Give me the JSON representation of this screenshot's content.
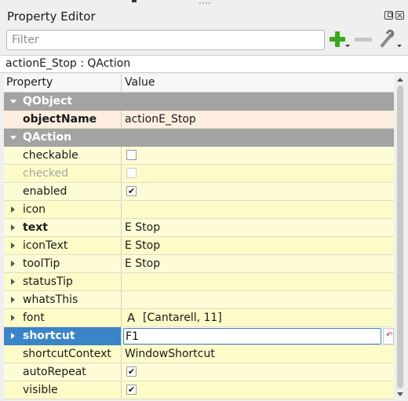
{
  "panel": {
    "title": "Property Editor",
    "filter_placeholder": "Filter",
    "object_label": "actionE_Stop : QAction"
  },
  "table": {
    "headers": {
      "property": "Property",
      "value": "Value"
    }
  },
  "rows": {
    "qobject": {
      "label": "QObject"
    },
    "objectName": {
      "label": "objectName",
      "value": "actionE_Stop"
    },
    "qaction": {
      "label": "QAction"
    },
    "checkable": {
      "label": "checkable",
      "checked": false
    },
    "checked": {
      "label": "checked",
      "checked": false,
      "enabled": false
    },
    "enabled": {
      "label": "enabled",
      "checked": true
    },
    "icon": {
      "label": "icon",
      "value": ""
    },
    "text": {
      "label": "text",
      "value": "E Stop"
    },
    "iconText": {
      "label": "iconText",
      "value": "E Stop"
    },
    "toolTip": {
      "label": "toolTip",
      "value": "E Stop"
    },
    "statusTip": {
      "label": "statusTip",
      "value": ""
    },
    "whatsThis": {
      "label": "whatsThis",
      "value": ""
    },
    "font": {
      "label": "font",
      "glyph": "A",
      "value": "[Cantarell, 11]"
    },
    "shortcut": {
      "label": "shortcut",
      "value": "F1"
    },
    "shortcutContext": {
      "label": "shortcutContext",
      "value": "WindowShortcut"
    },
    "autoRepeat": {
      "label": "autoRepeat",
      "checked": true
    },
    "visible": {
      "label": "visible",
      "checked": true
    }
  },
  "icons": [
    "add-property-icon",
    "remove-property-icon",
    "configure-icon",
    "float-icon",
    "close-icon",
    "reset-icon"
  ],
  "colors": {
    "group_header": "#a3a3a3",
    "qobject_row": "#fdeee0",
    "qaction_row": "#fdfcd6",
    "selection": "#3a84c8",
    "add_green": "#3aa71f"
  }
}
